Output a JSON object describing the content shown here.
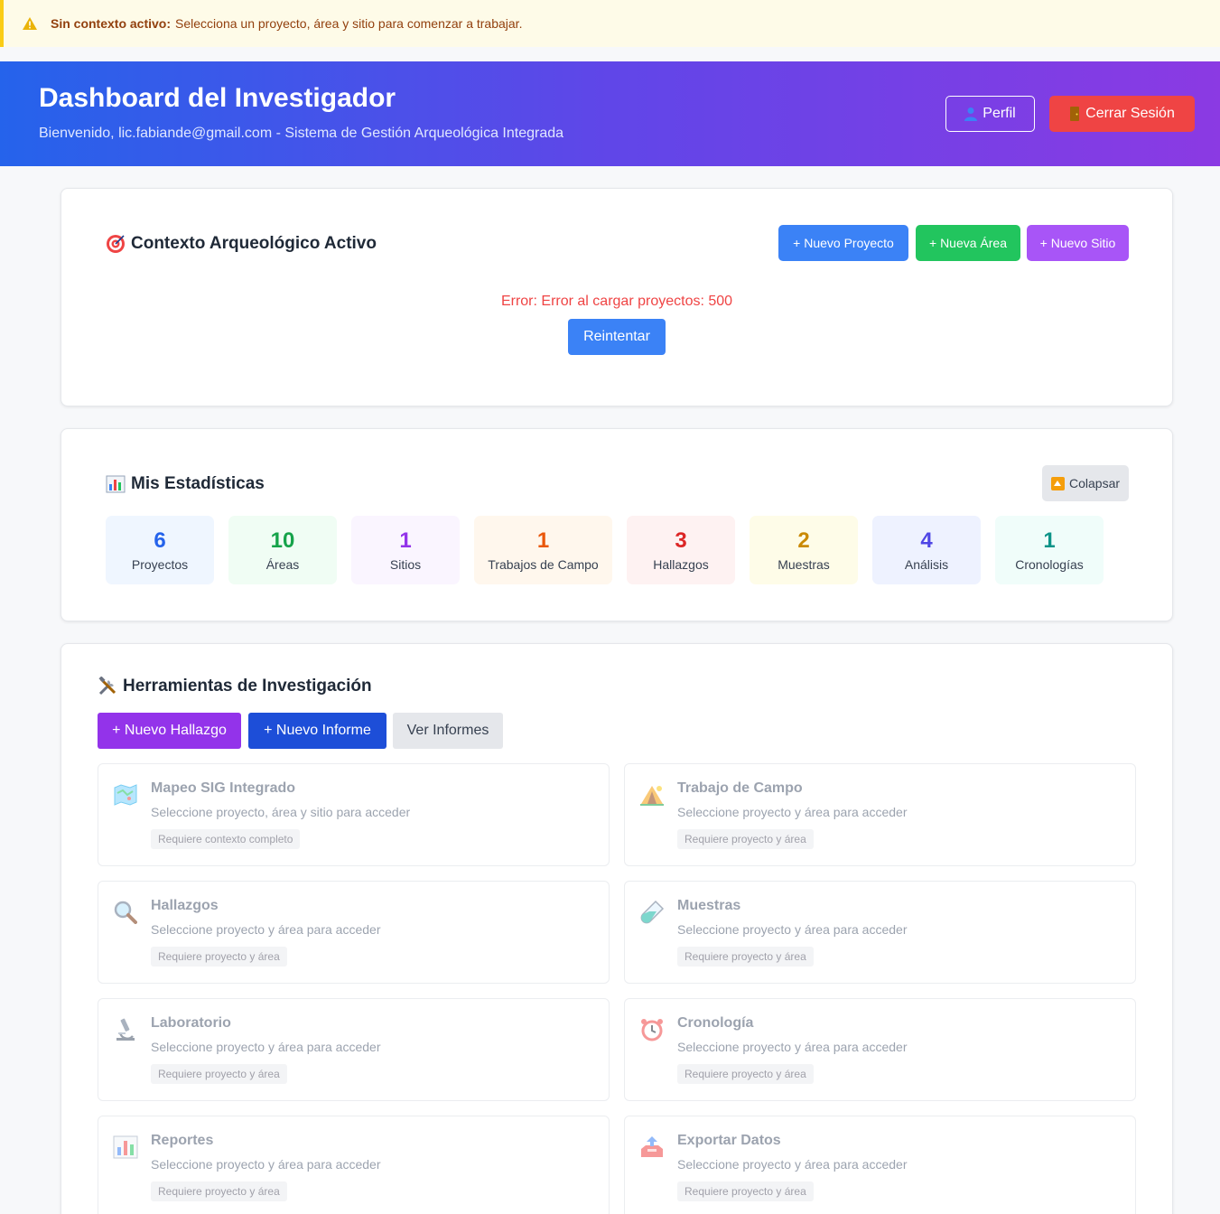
{
  "alert": {
    "bold": "Sin contexto activo:",
    "text": "Selecciona un proyecto, área y sitio para comenzar a trabajar."
  },
  "header": {
    "title": "Dashboard del Investigador",
    "subtitle": "Bienvenido, lic.fabiande@gmail.com - Sistema de Gestión Arqueológica Integrada",
    "profile_label": "Perfil",
    "logout_label": "Cerrar Sesión"
  },
  "context": {
    "title": "Contexto Arqueológico Activo",
    "new_project": "+ Nuevo Proyecto",
    "new_area": "+ Nueva Área",
    "new_site": "+ Nuevo Sitio",
    "error": "Error: Error al cargar proyectos: 500",
    "retry": "Reintentar"
  },
  "stats": {
    "title": "Mis Estadísticas",
    "collapse": "Colapsar",
    "items": [
      {
        "value": "6",
        "label": "Proyectos",
        "color": "#2563eb",
        "bg": "#eff6ff"
      },
      {
        "value": "10",
        "label": "Áreas",
        "color": "#16a34a",
        "bg": "#f0fdf4"
      },
      {
        "value": "1",
        "label": "Sitios",
        "color": "#9333ea",
        "bg": "#faf5ff"
      },
      {
        "value": "1",
        "label": "Trabajos de Campo",
        "color": "#ea580c",
        "bg": "#fff7ed"
      },
      {
        "value": "3",
        "label": "Hallazgos",
        "color": "#dc2626",
        "bg": "#fef2f2"
      },
      {
        "value": "2",
        "label": "Muestras",
        "color": "#ca8a04",
        "bg": "#fefce8"
      },
      {
        "value": "4",
        "label": "Análisis",
        "color": "#4f46e5",
        "bg": "#eef2ff"
      },
      {
        "value": "1",
        "label": "Cronologías",
        "color": "#0d9488",
        "bg": "#f0fdfa"
      }
    ]
  },
  "tools": {
    "title": "Herramientas de Investigación",
    "new_finding": "+ Nuevo Hallazgo",
    "new_report": "+ Nuevo Informe",
    "view_reports": "Ver Informes",
    "tiles": [
      {
        "name": "Mapeo SIG Integrado",
        "desc": "Seleccione proyecto, área y sitio para acceder",
        "badge": "Requiere contexto completo",
        "icon": "map-icon"
      },
      {
        "name": "Trabajo de Campo",
        "desc": "Seleccione proyecto y área para acceder",
        "badge": "Requiere proyecto y área",
        "icon": "tent-icon"
      },
      {
        "name": "Hallazgos",
        "desc": "Seleccione proyecto y área para acceder",
        "badge": "Requiere proyecto y área",
        "icon": "magnifier-icon"
      },
      {
        "name": "Muestras",
        "desc": "Seleccione proyecto y área para acceder",
        "badge": "Requiere proyecto y área",
        "icon": "test-tube-icon"
      },
      {
        "name": "Laboratorio",
        "desc": "Seleccione proyecto y área para acceder",
        "badge": "Requiere proyecto y área",
        "icon": "microscope-icon"
      },
      {
        "name": "Cronología",
        "desc": "Seleccione proyecto y área para acceder",
        "badge": "Requiere proyecto y área",
        "icon": "alarm-clock-icon"
      },
      {
        "name": "Reportes",
        "desc": "Seleccione proyecto y área para acceder",
        "badge": "Requiere proyecto y área",
        "icon": "bar-chart-icon"
      },
      {
        "name": "Exportar Datos",
        "desc": "Seleccione proyecto y área para acceder",
        "badge": "Requiere proyecto y área",
        "icon": "outbox-tray-icon"
      }
    ]
  }
}
